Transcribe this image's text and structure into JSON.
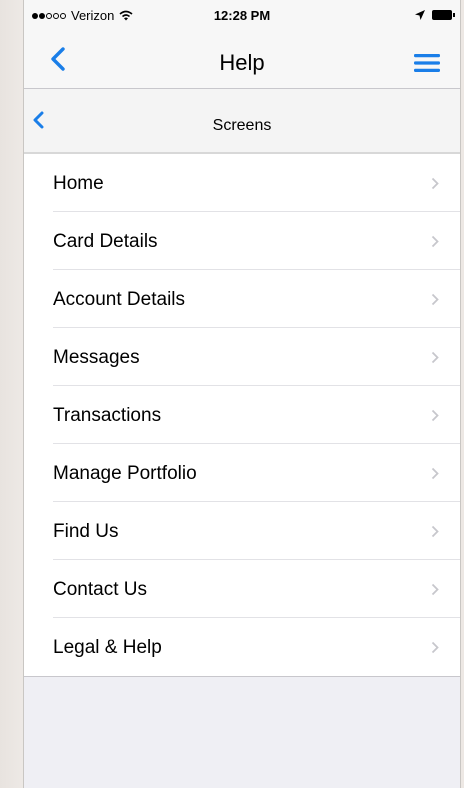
{
  "status_bar": {
    "carrier": "Verizon",
    "time": "12:28 PM",
    "signal_bars_filled": 2,
    "signal_bars_total": 5
  },
  "nav": {
    "title": "Help",
    "back_icon": "chevron-left-icon",
    "menu_icon": "hamburger-menu-icon"
  },
  "sub_header": {
    "title": "Screens",
    "back_icon": "chevron-left-icon"
  },
  "menu": {
    "items": [
      {
        "label": "Home"
      },
      {
        "label": "Card Details"
      },
      {
        "label": "Account Details"
      },
      {
        "label": "Messages"
      },
      {
        "label": "Transactions"
      },
      {
        "label": "Manage Portfolio"
      },
      {
        "label": "Find Us"
      },
      {
        "label": "Contact Us"
      },
      {
        "label": "Legal & Help"
      }
    ]
  },
  "colors": {
    "accent": "#1a7ee8",
    "chevron": "#c7c7cc",
    "background": "#efeff4"
  }
}
